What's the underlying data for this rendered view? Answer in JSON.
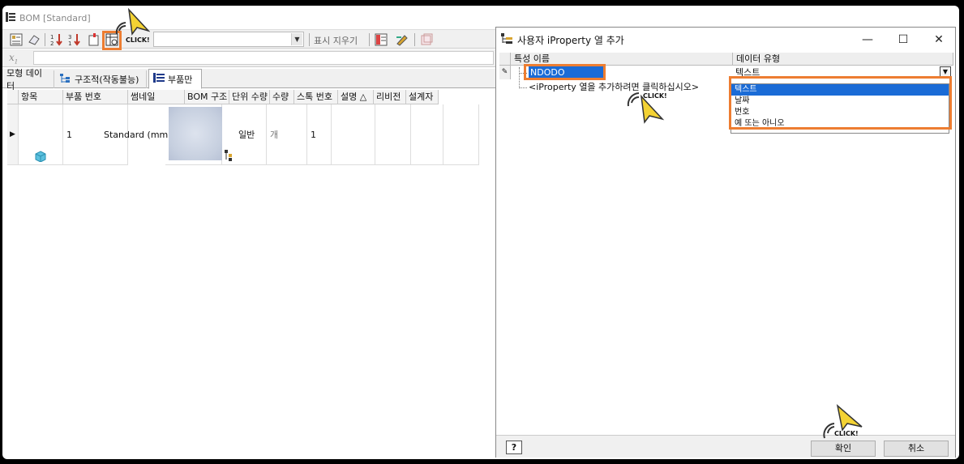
{
  "bom": {
    "title": "BOM [Standard]",
    "show_hide_label": "표시 지우기",
    "tabs": [
      {
        "label": "모형 데이터"
      },
      {
        "label": "구조적(작동불능)"
      },
      {
        "label": "부품만"
      }
    ],
    "columns": [
      "항목",
      "부품 번호",
      "썸네일",
      "BOM 구조",
      "단위 수량",
      "수량",
      "스톡 번호",
      "설명 △",
      "리비전",
      "설계자"
    ],
    "row": {
      "item": "1",
      "part_number": "Standard (mm)",
      "bom_structure": "일반",
      "unit_qty": "개",
      "qty": "1"
    }
  },
  "dialog": {
    "title": "사용자 iProperty 열 추가",
    "col_name_header": "특성 이름",
    "col_type_header": "데이터 유형",
    "name_value": "NDODO",
    "type_value": "텍스트",
    "add_row_hint": "<iProperty 열을 추가하려면 클릭하십시오>",
    "type_options": [
      "텍스트",
      "날짜",
      "번호",
      "예 또는 아니오"
    ],
    "selected_option_index": 0,
    "help_label": "?",
    "ok_label": "확인",
    "cancel_label": "취소"
  },
  "annotations": {
    "click_text": "CLICK!",
    "highlight_color": "#ed7d31",
    "cursor_color": "#f3d233"
  }
}
